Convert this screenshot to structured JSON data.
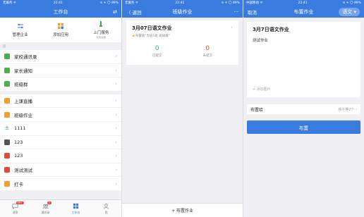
{
  "screen1": {
    "status_left": "无服务 ᯤ",
    "status_time": "22:41",
    "status_right": "⊙ ✈ 〇 89%",
    "title": "工作台",
    "quick": [
      {
        "label": "管理企业",
        "sub": "",
        "icon": "sliders-icon",
        "color": "#3a7be0"
      },
      {
        "label": "添加应用",
        "sub": "",
        "icon": "add-app-icon",
        "color": "#f0a020"
      },
      {
        "label": "上门服务",
        "sub": "在线运营",
        "icon": "service-icon",
        "color": "#3aa860"
      }
    ],
    "section_label": "班",
    "group1": [
      {
        "label": "家校通讯录",
        "color": "#4caf50"
      },
      {
        "label": "家长通知",
        "color": "#4caf50"
      },
      {
        "label": "班级群",
        "color": "#4caf50"
      }
    ],
    "group2": [
      {
        "label": "上课直播",
        "color": "#f0a030"
      },
      {
        "label": "班级作业",
        "color": "#f0a030"
      },
      {
        "label": "1111",
        "color": "#3aa860"
      },
      {
        "label": "123",
        "color": "#555555"
      },
      {
        "label": "123",
        "color": "#e04b3c"
      },
      {
        "label": "测试测试",
        "color": "#e04b3c"
      },
      {
        "label": "打卡",
        "color": "#f0a030"
      }
    ],
    "tabs": [
      {
        "label": "消息",
        "badge": "99+"
      },
      {
        "label": "通讯录",
        "badge": "2"
      },
      {
        "label": "工作台",
        "badge": ""
      },
      {
        "label": "我",
        "badge": ""
      }
    ]
  },
  "screen2": {
    "status_left": "无服务 ᯤ",
    "status_time": "22:41",
    "status_right": "⊙ ✈ 〇 89%",
    "back": "〈 返回",
    "title": "班级作业",
    "more": "···",
    "card_title": "3月07日语文作业",
    "card_sub": "布置给\"大班1班 班级群\"",
    "submitted_count": "0",
    "submitted_label": "已提交",
    "unsubmitted_count": "0",
    "unsubmitted_label": "未提交",
    "bottom_action": "+ 布置作业"
  },
  "screen3": {
    "status_left": "中国移动 ᯤ",
    "status_time": "22:41",
    "status_right": "⊙ ✈ 〇 89%",
    "cancel": "取消",
    "title": "布置作业",
    "pill": "语文 ▾",
    "edit_title": "3月7日语文作业",
    "edit_content": "测试作业",
    "add_image": "+ 添加图片",
    "assign_label": "布置给",
    "assign_value": "孩子等2个 ›",
    "submit": "布置"
  },
  "colors": {
    "primary": "#3a7be0",
    "badge": "#e64340",
    "green": "#3aa860",
    "red": "#e04b3c"
  }
}
